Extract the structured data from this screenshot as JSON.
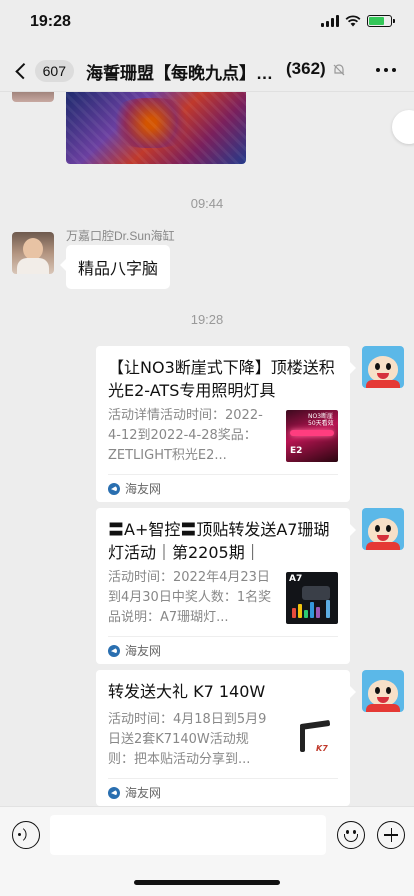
{
  "status_bar": {
    "time": "19:28",
    "battery_level": 0.7,
    "battery_color": "#34c759"
  },
  "nav": {
    "back_badge": "607",
    "title": "海誓珊盟【每晚九点】…",
    "member_count": "(362)",
    "mute_icon": "mute-bell-icon",
    "more_icon": "more-icon"
  },
  "messages": {
    "timestamp_1": "09:44",
    "sender_1": "万嘉口腔Dr.Sun海缸",
    "text_1": "精品八字脑",
    "timestamp_2": "19:28"
  },
  "cards": [
    {
      "title": "【让NO3断崖式下降】顶楼送积光E2-ATS专用照明灯具",
      "desc": "活动详情活动时间：2022-4-12到2022-4-28奖品：ZETLIGHT积光E2...",
      "thumb_title": "NO3断崖 50天看效",
      "thumb_label": "E2",
      "source": "海友网"
    },
    {
      "title": "〓A+智控〓顶贴转发送A7珊瑚灯活动｜第2205期｜",
      "desc": "活动时间：2022年4月23日到4月30日中奖人数：1名奖品说明：A7珊瑚灯...",
      "thumb_label": "A7",
      "source": "海友网"
    },
    {
      "title": "转发送大礼 K7 140W",
      "desc": "活动时间：4月18日到5月9日送2套K7140W活动规则：把本贴活动分享到...",
      "thumb_label": "K7",
      "source": "海友网"
    }
  ],
  "input_bar": {
    "placeholder": "",
    "voice_icon": "voice-icon",
    "emoji_icon": "emoji-icon",
    "plus_icon": "plus-icon"
  }
}
